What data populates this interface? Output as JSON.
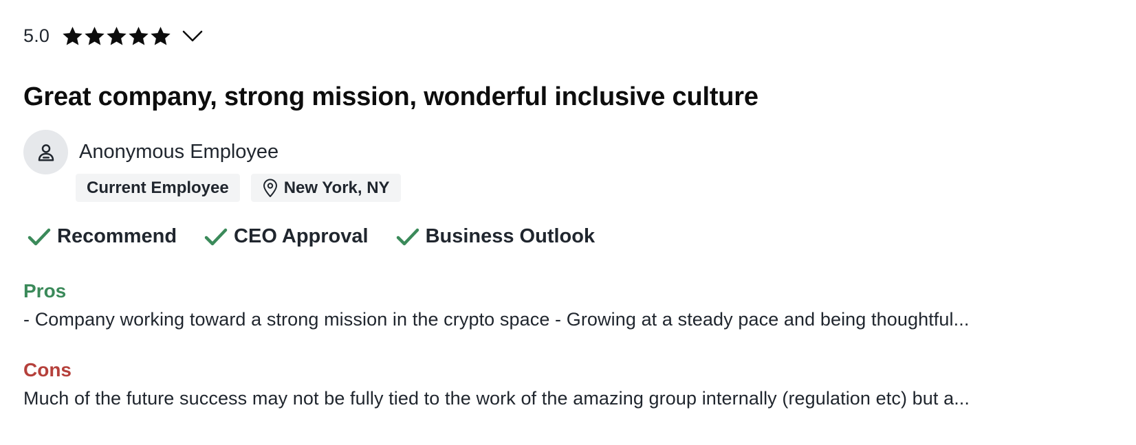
{
  "rating": {
    "value": "5.0",
    "stars": 5,
    "star_icon": "star-icon",
    "chevron_icon": "chevron-down-icon"
  },
  "review": {
    "title": "Great company, strong mission, wonderful inclusive culture",
    "author": {
      "name": "Anonymous Employee",
      "avatar_icon": "person-icon"
    },
    "tags": {
      "status": "Current Employee",
      "location": "New York, NY",
      "location_icon": "location-pin-icon"
    },
    "checks": [
      {
        "label": "Recommend",
        "icon": "checkmark-icon"
      },
      {
        "label": "CEO Approval",
        "icon": "checkmark-icon"
      },
      {
        "label": "Business Outlook",
        "icon": "checkmark-icon"
      }
    ],
    "pros": {
      "label": "Pros",
      "text": "- Company working toward a strong mission in the crypto space - Growing at a steady pace and being thoughtful..."
    },
    "cons": {
      "label": "Cons",
      "text": "Much of the future success may not be fully tied to the work of the amazing group internally (regulation etc) but a..."
    }
  },
  "colors": {
    "text": "#20262e",
    "check_green": "#3b8a5a",
    "pros_green": "#3b8a5a",
    "cons_red": "#b5403b",
    "tag_bg": "#f3f4f5",
    "avatar_bg": "#e6e8eb"
  }
}
